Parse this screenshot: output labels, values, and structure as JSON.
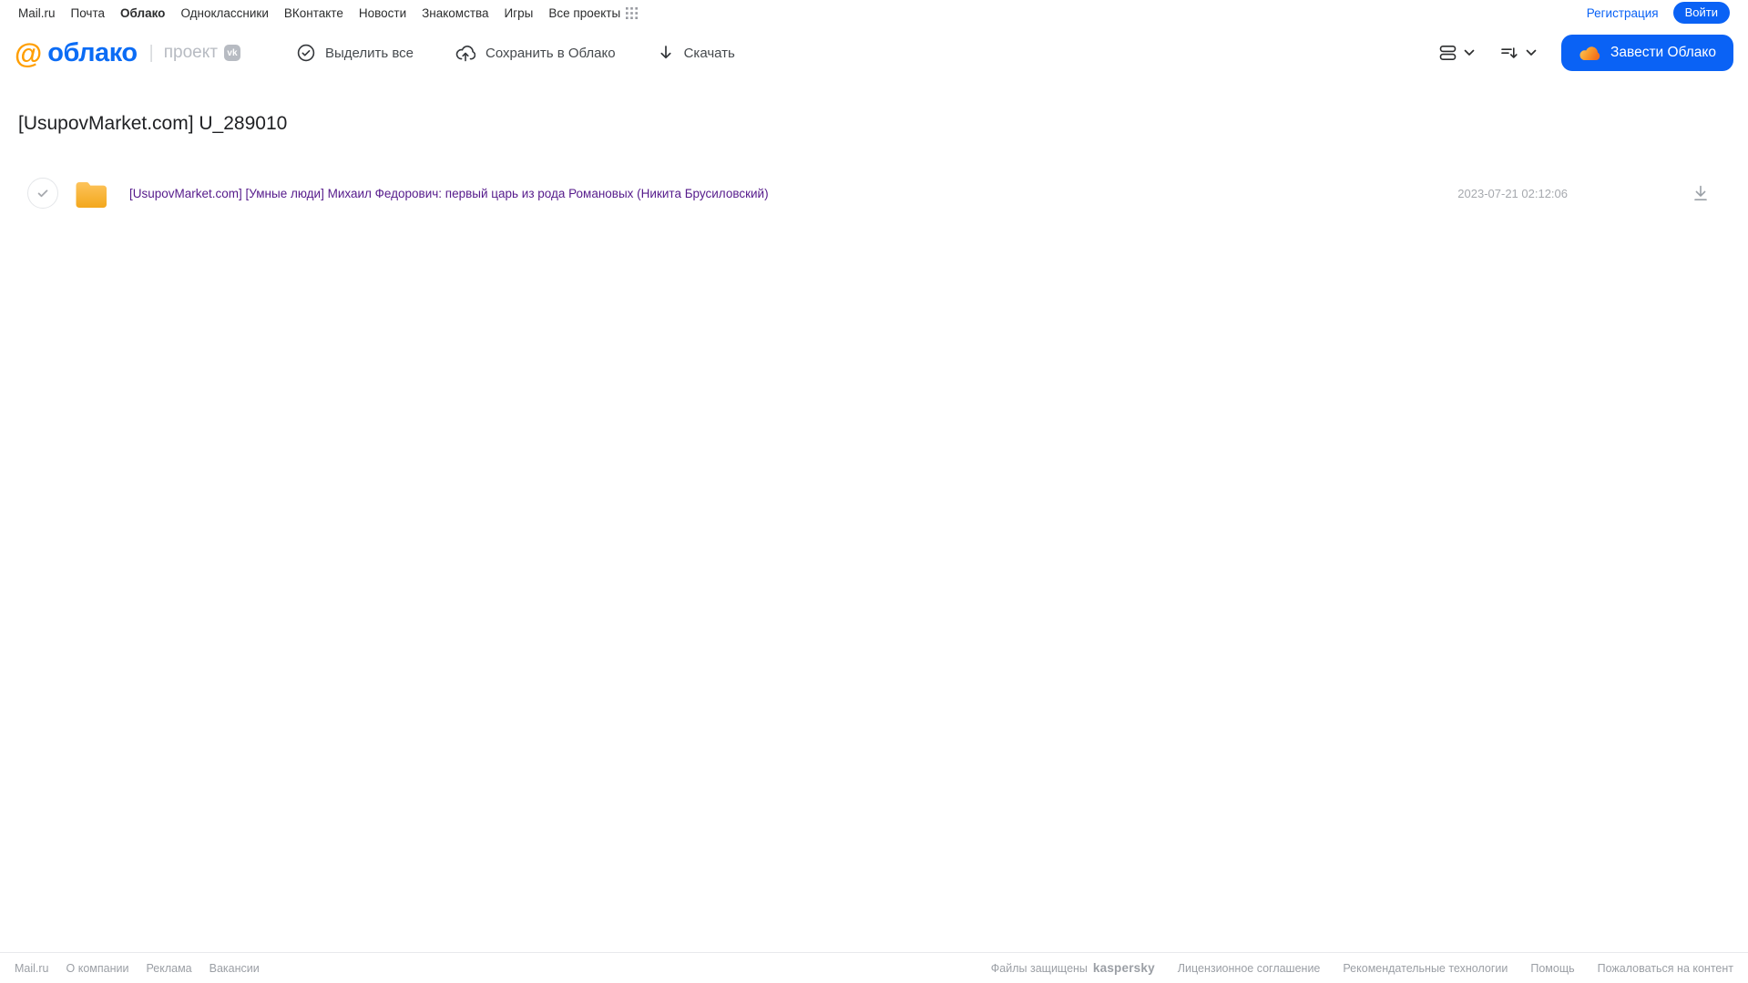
{
  "top_nav": {
    "links": [
      "Mail.ru",
      "Почта",
      "Облако",
      "Одноклассники",
      "ВКонтакте",
      "Новости",
      "Знакомства",
      "Игры",
      "Все проекты"
    ],
    "active_link": "Облако",
    "registration_label": "Регистрация",
    "login_label": "Войти"
  },
  "header": {
    "at_symbol": "@",
    "logo_text": "облако",
    "divider": "|",
    "project_label": "проект",
    "vk_badge": "vk",
    "toolbar": {
      "select_all_label": "Выделить все",
      "save_to_cloud_label": "Сохранить в Облако",
      "download_label": "Скачать"
    },
    "get_cloud_label": "Завести Облако"
  },
  "page": {
    "title": "[UsupovMarket.com] U_289010"
  },
  "file_list": {
    "items": [
      {
        "type": "folder",
        "name": "[UsupovMarket.com] [Умные люди] Михаил Федорович: первый царь из рода Романовых (Никита Брусиловский)",
        "modified": "2023-07-21 02:12:06"
      }
    ]
  },
  "footer": {
    "left_links": [
      "Mail.ru",
      "О компании",
      "Реклама",
      "Вакансии"
    ],
    "protected_label": "Файлы защищены",
    "kaspersky_label": "kaspersky",
    "right_links": [
      "Лицензионное соглашение",
      "Рекомендательные технологии",
      "Помощь",
      "Пожаловаться на контент"
    ]
  },
  "colors": {
    "accent_blue": "#0a62f5",
    "logo_orange": "#ff9e00",
    "folder_yellow_top": "#fdc45c",
    "folder_yellow_bottom": "#f3a71c",
    "kaspersky_green": "#00a88e",
    "visited_link_purple": "#551a8b",
    "muted_text": "#9aa0a6"
  }
}
